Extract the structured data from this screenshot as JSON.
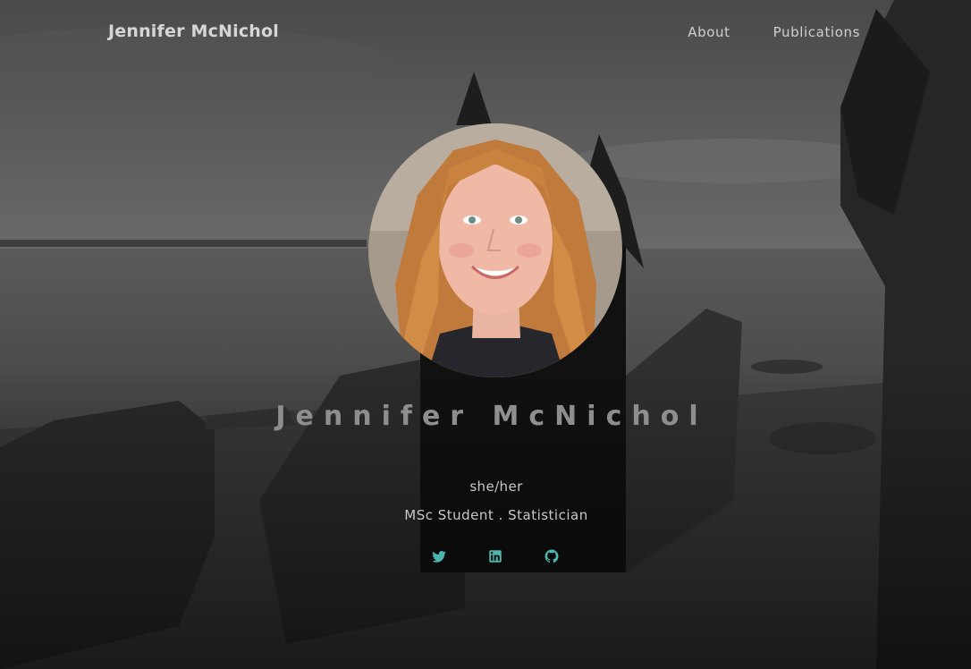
{
  "site": {
    "brand": "Jennifer McNichol"
  },
  "nav": {
    "items": [
      {
        "label": "About"
      },
      {
        "label": "Publications"
      }
    ]
  },
  "hero": {
    "name": "Jennifer McNichol",
    "pronouns": "she/her",
    "role": "MSc Student . Statistician"
  },
  "socials": [
    {
      "icon": "twitter-icon"
    },
    {
      "icon": "linkedin-icon"
    },
    {
      "icon": "github-icon"
    }
  ],
  "colors": {
    "accent": "#4db6ac",
    "text": "#d6d6d6",
    "name": "#8e8e8e"
  }
}
